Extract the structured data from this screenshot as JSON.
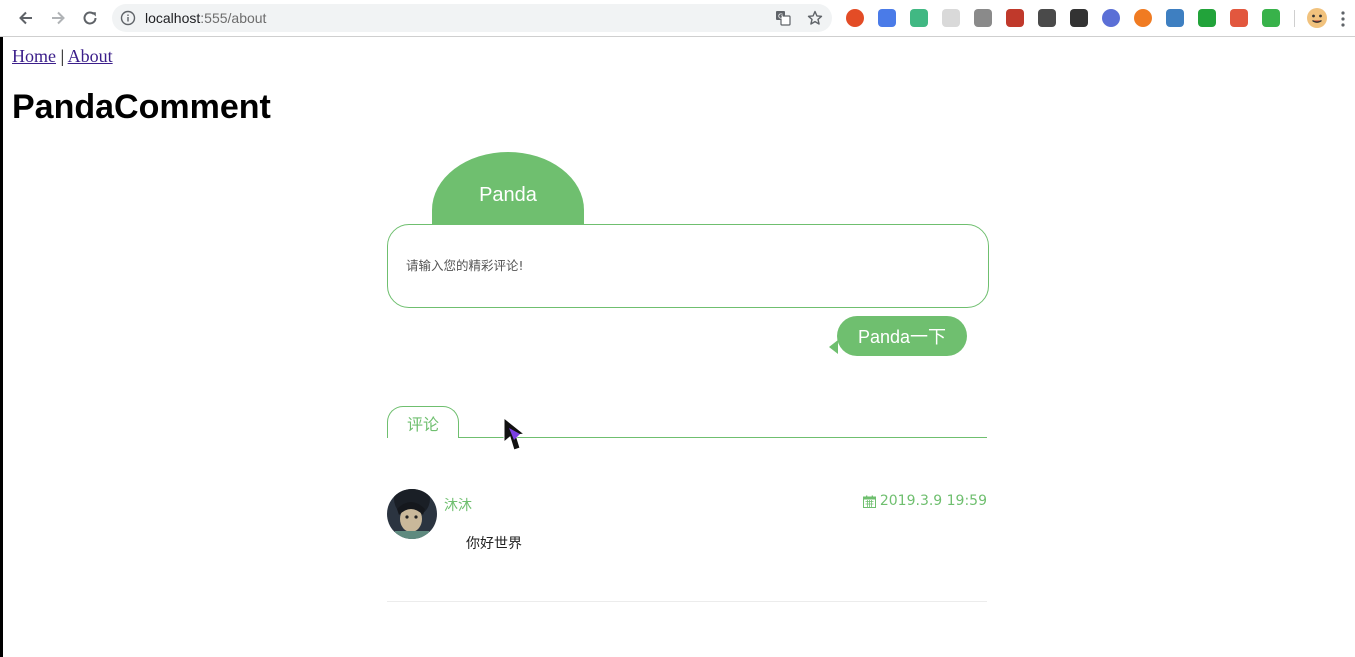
{
  "browser": {
    "url_host": "localhost",
    "url_path": ":555/about",
    "extensions": [
      {
        "name": "ext-red-circle-icon",
        "color": "#e34c26"
      },
      {
        "name": "ext-translate-icon",
        "color": "#4a7be8"
      },
      {
        "name": "ext-vue-devtools-icon",
        "color": "#41b883"
      },
      {
        "name": "ext-grid-icon",
        "color": "#d9d9d9"
      },
      {
        "name": "ext-link-icon",
        "color": "#8a8a8a"
      },
      {
        "name": "ext-js-icon",
        "color": "#c0392b"
      },
      {
        "name": "ext-eyedropper-icon",
        "color": "#4a4a4a"
      },
      {
        "name": "ext-fx-icon",
        "color": "#333333"
      },
      {
        "name": "ext-r-icon",
        "color": "#5b6fd6"
      },
      {
        "name": "ext-orange-ring-icon",
        "color": "#f07b22"
      },
      {
        "name": "ext-hash-icon",
        "color": "#3e7fc1"
      },
      {
        "name": "ext-green-square-icon",
        "color": "#22a33a"
      },
      {
        "name": "ext-octocat-icon",
        "color": "#e2573e"
      },
      {
        "name": "ext-rocket-icon",
        "color": "#38b24a"
      }
    ]
  },
  "nav": {
    "home": "Home",
    "separator": "|",
    "about": "About"
  },
  "page": {
    "title": "PandaComment"
  },
  "comment_form": {
    "name_tab": "Panda",
    "placeholder": "请输入您的精彩评论!",
    "submit_label": "Panda一下"
  },
  "comments_section": {
    "tab_label": "评论",
    "items": [
      {
        "author": "沐沐",
        "date": "2019.3.9 19:59",
        "text": "你好世界"
      }
    ]
  },
  "colors": {
    "accent": "#6fbf6f",
    "link": "#3b1e8a"
  }
}
